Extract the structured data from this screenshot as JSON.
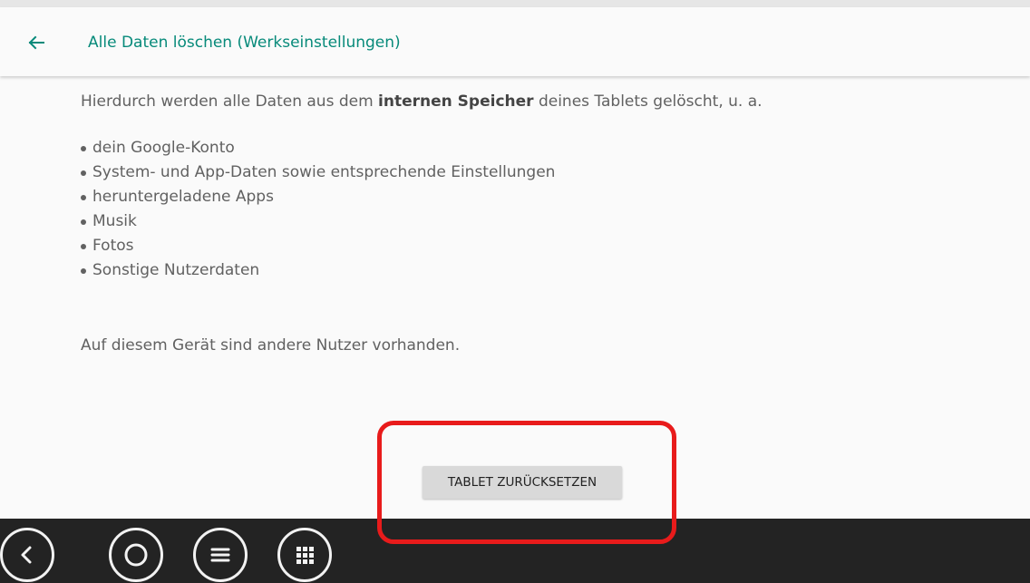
{
  "header": {
    "title": "Alle Daten löschen (Werkseinstellungen)",
    "back_icon": "back-arrow-icon",
    "accent_color": "#078a7a"
  },
  "content": {
    "intro_before": "Hierdurch werden alle Daten aus dem ",
    "intro_bold": "internen Speicher",
    "intro_after": " deines Tablets gelöscht, u. a.",
    "items": [
      "dein Google-Konto",
      "System- und App-Daten sowie entsprechende Einstellungen",
      "heruntergeladene Apps",
      "Musik",
      "Fotos",
      "Sonstige Nutzerdaten"
    ],
    "note": "Auf diesem Gerät sind andere Nutzer vorhanden."
  },
  "actions": {
    "reset_label": "TABLET ZURÜCKSETZEN"
  },
  "annotation": {
    "highlight_color": "#e81b1b"
  },
  "navbar": {
    "buttons": [
      "back-icon",
      "home-icon",
      "menu-icon",
      "apps-grid-icon"
    ]
  }
}
